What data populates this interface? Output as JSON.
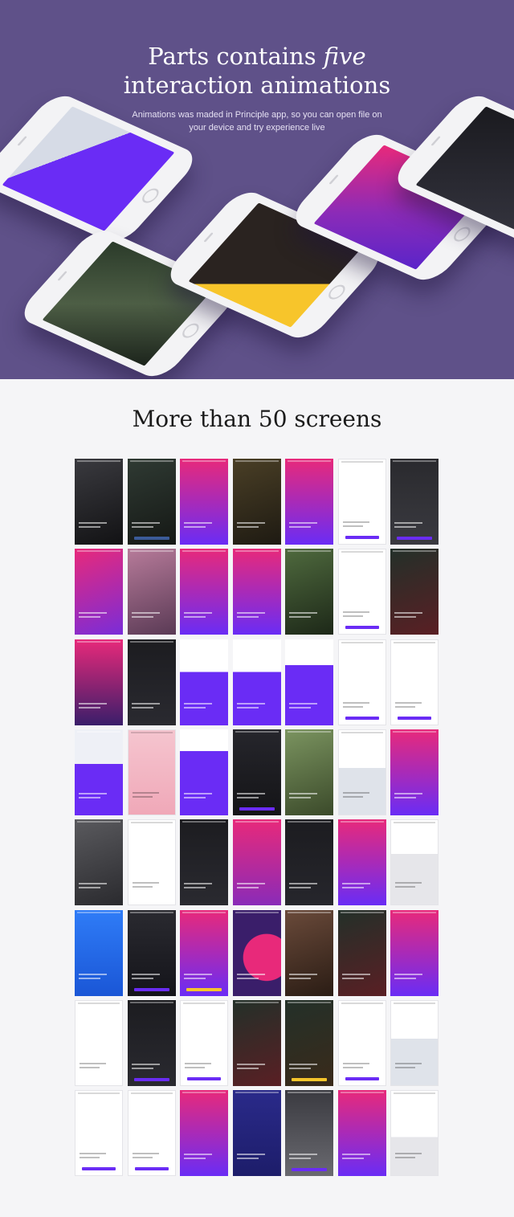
{
  "hero": {
    "title_part1": "Parts contains",
    "title_emph": "five",
    "title_line2": "interaction animations",
    "subtitle_line1": "Animations was maded in Principle app, so you can open file on",
    "subtitle_line2": "your device and try experience live"
  },
  "screens_section": {
    "title": "More than 50 screens"
  },
  "colors": {
    "hero_bg": "#5f5189",
    "page_bg": "#f5f5f7",
    "accent_purple": "#6a2cf5",
    "accent_pink": "#e8297a",
    "accent_yellow": "#f7c52b"
  },
  "hero_phones": [
    {
      "screen": "purple-photo"
    },
    {
      "screen": "forest-dark"
    },
    {
      "screen": "food-yellow"
    },
    {
      "screen": "magenta-diamond"
    },
    {
      "screen": "dark-preorder"
    }
  ],
  "grid": {
    "rows": [
      [
        "dark-vr",
        "dark-login",
        "purple-gradient",
        "food-dark",
        "magenta-diamond",
        "white-heart",
        "dark-portrait"
      ],
      [
        "magenta-photo",
        "building-pink",
        "purple-gradient",
        "purple-play",
        "forest-green",
        "white-camera",
        "dark-berries"
      ],
      [
        "purple-dark",
        "dark-rift",
        "purple-white-card",
        "purple-white-card",
        "purple-phone",
        "white-list",
        "white-check"
      ],
      [
        "purple-phones",
        "pink-phones",
        "purple-form",
        "dark-preorder",
        "green-people",
        "white-road",
        "magenta-road"
      ],
      [
        "dark-rider",
        "white-diamond",
        "dark-list",
        "magenta-journey",
        "dark-diamond",
        "magenta-form",
        "white-bird"
      ],
      [
        "blue-play",
        "dark-journey",
        "magenta-library",
        "magenta-circle",
        "dark-dog",
        "dark-berries",
        "magenta-road"
      ],
      [
        "white-bulb",
        "dark-signup",
        "white-parts",
        "dark-berries",
        "dark-yellow",
        "white-camera",
        "white-road"
      ],
      [
        "white-signin",
        "white-signin",
        "magenta-parts",
        "navy-parts",
        "dark-phone-modal",
        "magenta-road",
        "white-quote"
      ]
    ]
  }
}
